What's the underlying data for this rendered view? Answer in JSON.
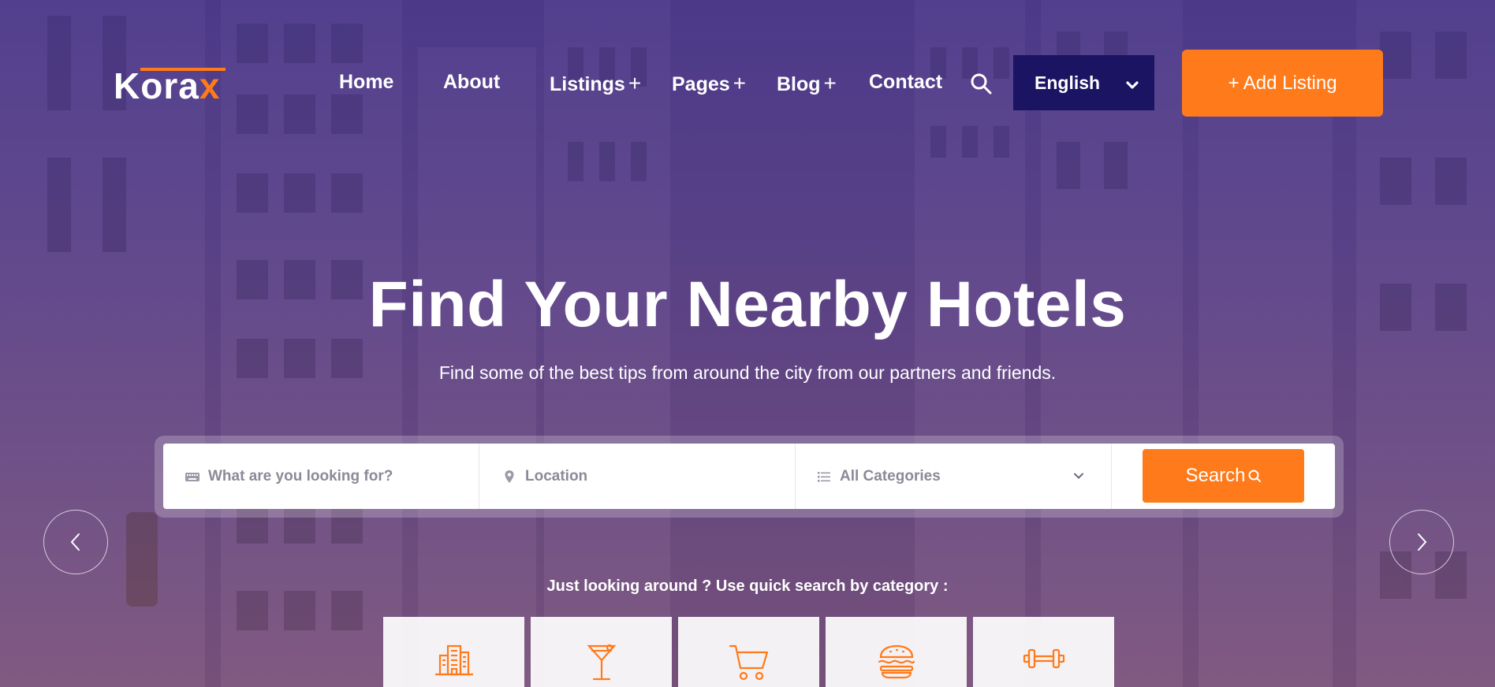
{
  "brand": {
    "logo_text_main": "Kora",
    "logo_text_accent": "x",
    "accent_color": "#ff7a1a",
    "dark_color": "#1a1463"
  },
  "nav": {
    "items": [
      {
        "label": "Home",
        "has_submenu": false
      },
      {
        "label": "About",
        "has_submenu": false
      },
      {
        "label": "Listings",
        "has_submenu": true
      },
      {
        "label": "Pages",
        "has_submenu": true
      },
      {
        "label": "Blog",
        "has_submenu": true
      },
      {
        "label": "Contact",
        "has_submenu": false
      }
    ],
    "submenu_symbol": "+",
    "language": "English",
    "add_listing": "+ Add Listing"
  },
  "hero": {
    "title": "Find Your Nearby Hotels",
    "subtitle": "Find some of the best tips from around the city from our partners and friends."
  },
  "search": {
    "keyword_placeholder": "What are you looking for?",
    "location_placeholder": "Location",
    "category_selected": "All Categories",
    "button_label": "Search"
  },
  "quick_search": {
    "label": "Just looking around ? Use quick search by category :",
    "categories": [
      {
        "icon": "building-icon"
      },
      {
        "icon": "cocktail-icon"
      },
      {
        "icon": "shopping-cart-icon"
      },
      {
        "icon": "burger-icon"
      },
      {
        "icon": "dumbbell-icon"
      }
    ]
  }
}
